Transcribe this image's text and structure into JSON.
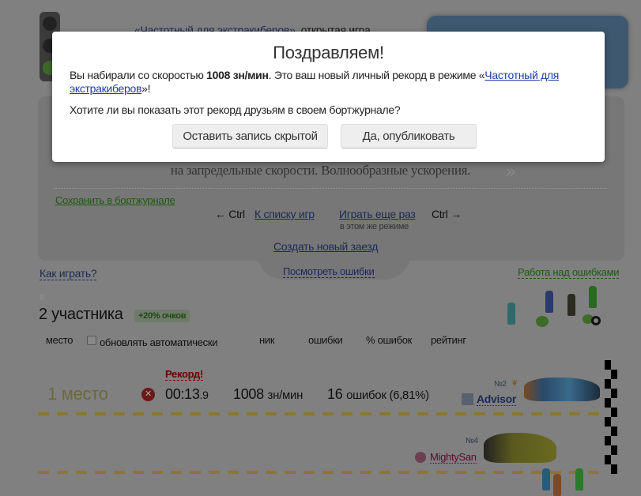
{
  "header": {
    "mode_link": "«Частотный для экстракиберов»",
    "mode_suffix": ", открытая игра"
  },
  "panel": {
    "text_tail": "на запредельные скорости. Волнообразные ускорения.",
    "save_link": "Сохранить в бортжурнале",
    "prev_hint": "← Ctrl",
    "back_link": "К списку игр",
    "replay_link": "Играть еще раз",
    "next_hint": "Ctrl →",
    "replay_sub": "в этом же режиме",
    "new_race_link": "Создать новый заезд"
  },
  "links": {
    "how_to_play": "Как играть?",
    "view_errors": "Посмотреть ошибки",
    "work_on_errors": "Работа над ошибками"
  },
  "participants": {
    "title": "2 участника",
    "bonus": "+20% очков"
  },
  "columns": {
    "place": "место",
    "auto_update": "обновлять автоматически",
    "nick": "ник",
    "errors": "ошибки",
    "error_pct": "% ошибок",
    "rating": "рейтинг"
  },
  "results": [
    {
      "record": "Рекорд!",
      "place": "1 место",
      "time": "00:13",
      "time_frac": ".9",
      "speed": "1008",
      "speed_unit": "зн/мин",
      "errors": "16",
      "errors_text": "ошибок (6,81%)",
      "rank": "№2",
      "nick": "Advisor"
    },
    {
      "rank": "№4",
      "nick": "MightySan"
    }
  ],
  "modal": {
    "title": "Поздравляем!",
    "line1_pre": "Вы набирали со скоростью ",
    "line1_bold": "1008 зн/мин",
    "line1_mid": ". Это ваш новый личный рекорд в режиме «",
    "mode_link": "Частотный для экстракиберов",
    "line1_end": "»!",
    "question": "Хотите ли вы показать этот рекорд друзьям в своем бортжурнале?",
    "hide_button": "Оставить запись скрытой",
    "publish_button": "Да, опубликовать"
  }
}
